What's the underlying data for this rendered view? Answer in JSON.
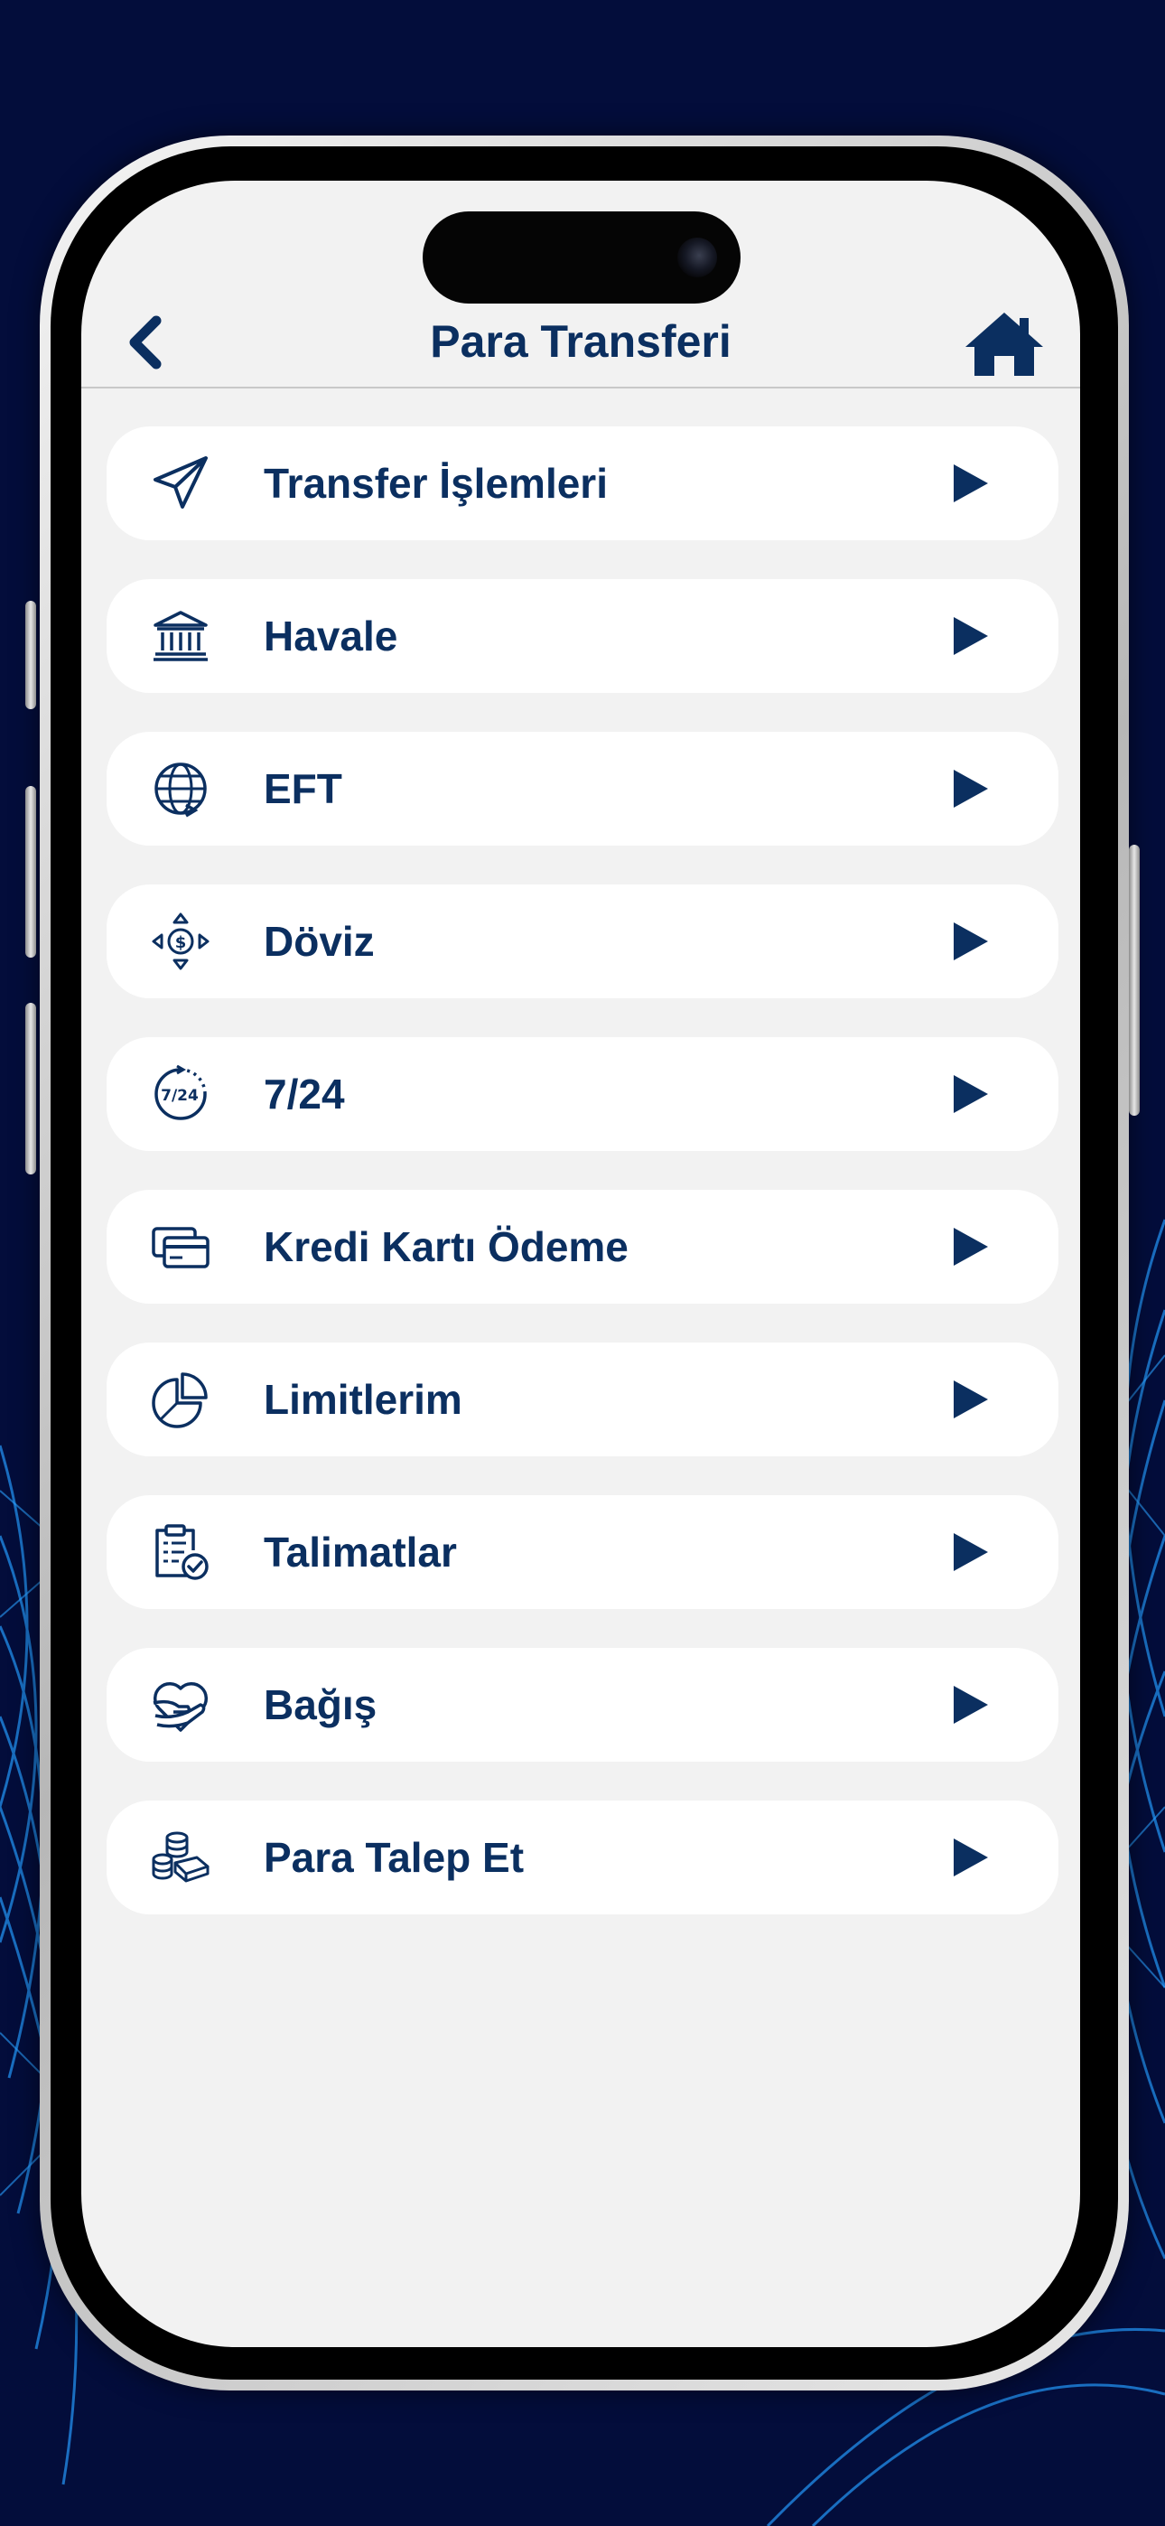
{
  "header": {
    "title": "Para Transferi",
    "back_icon": "chevron-left-icon",
    "home_icon": "home-icon"
  },
  "colors": {
    "background": "#030d3b",
    "screen": "#f2f2f2",
    "accent": "#0b2f60",
    "card": "#ffffff"
  },
  "menu": {
    "items": [
      {
        "label": "Transfer İşlemleri",
        "icon": "paper-plane-icon"
      },
      {
        "label": "Havale",
        "icon": "bank-icon"
      },
      {
        "label": "EFT",
        "icon": "globe-transfer-icon"
      },
      {
        "label": "Döviz",
        "icon": "currency-exchange-icon"
      },
      {
        "label": "7/24",
        "icon": "clock-247-icon"
      },
      {
        "label": "Kredi Kartı Ödeme",
        "icon": "credit-card-icon"
      },
      {
        "label": "Limitlerim",
        "icon": "pie-chart-icon"
      },
      {
        "label": "Talimatlar",
        "icon": "clipboard-check-icon"
      },
      {
        "label": "Bağış",
        "icon": "donation-heart-icon"
      },
      {
        "label": "Para Talep Et",
        "icon": "coins-stack-icon"
      }
    ]
  }
}
